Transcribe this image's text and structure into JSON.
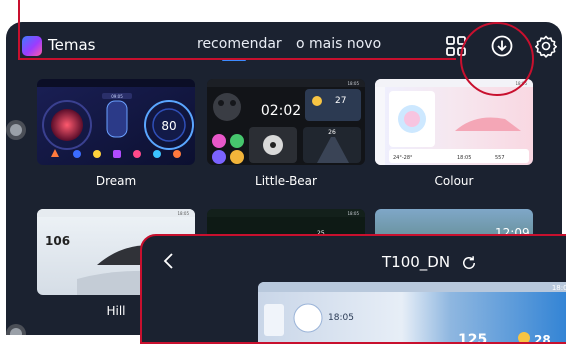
{
  "app": {
    "title": "Temas"
  },
  "tabs": [
    {
      "label": "recomendar"
    },
    {
      "label": "o mais novo"
    }
  ],
  "header_icons": [
    "grid-icon",
    "download-icon",
    "settings-icon"
  ],
  "themes": [
    {
      "name": "Dream",
      "thumb": {
        "speed": "80",
        "mini": "09:05"
      }
    },
    {
      "name": "Little-Bear",
      "thumb": {
        "time": "02:02",
        "temp": "27",
        "status_time": "18:05",
        "speed": "26"
      }
    },
    {
      "name": "Colour",
      "thumb": {
        "temp_range": "24°-28°",
        "time": "18:05",
        "num": "557",
        "status_time": "18:05"
      }
    },
    {
      "name": "Hill",
      "thumb": {
        "speed": "106",
        "status_time": "18:05"
      }
    },
    {
      "name": "",
      "thumb": {
        "status_time": "18:05",
        "speed": "25"
      }
    },
    {
      "name": "",
      "thumb": {
        "time": "12:09"
      }
    }
  ],
  "overlay": {
    "title": "T100_DN",
    "preview": {
      "time": "18:05",
      "speed": "125",
      "status_time": "18:05",
      "temp": "28"
    }
  },
  "colors": {
    "accent": "#3d8bff",
    "annotation": "#c8102e",
    "background": "#1b2230"
  }
}
